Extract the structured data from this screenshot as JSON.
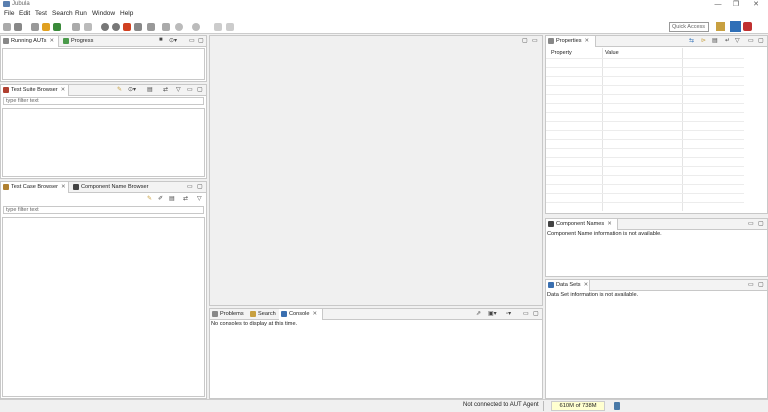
{
  "window": {
    "title": "Jubula",
    "controls": [
      "—",
      "❐",
      "✕"
    ]
  },
  "menu": [
    "File",
    "Edit",
    "Test",
    "Search",
    "Run",
    "Window",
    "Help"
  ],
  "toolbar": {
    "quick_access_placeholder": "Quick Access"
  },
  "left_top": {
    "tabs": [
      "Running AUTs",
      "Progress"
    ]
  },
  "test_suite_browser": {
    "tab": "Test Suite Browser",
    "filter_placeholder": "type filter text"
  },
  "test_case_browser": {
    "tabs": [
      "Test Case Browser",
      "Component Name Browser"
    ],
    "filter_placeholder": "type filter text"
  },
  "bottom_center": {
    "tabs": [
      "Problems",
      "Search",
      "Console"
    ],
    "message": "No consoles to display at this time."
  },
  "properties": {
    "tab": "Properties",
    "columns": [
      "Property",
      "Value"
    ]
  },
  "component_names": {
    "tab": "Component Names",
    "message": "Component Name information is not available."
  },
  "data_sets": {
    "tab": "Data Sets",
    "message": "Data Set information is not available."
  },
  "status": {
    "connection": "Not connected to AUT Agent",
    "memory": "610M of 738M"
  },
  "colors": {
    "accent": "#2f6fb7",
    "brand": "#5a7fb0",
    "memory_bg": "#ffffd0"
  }
}
